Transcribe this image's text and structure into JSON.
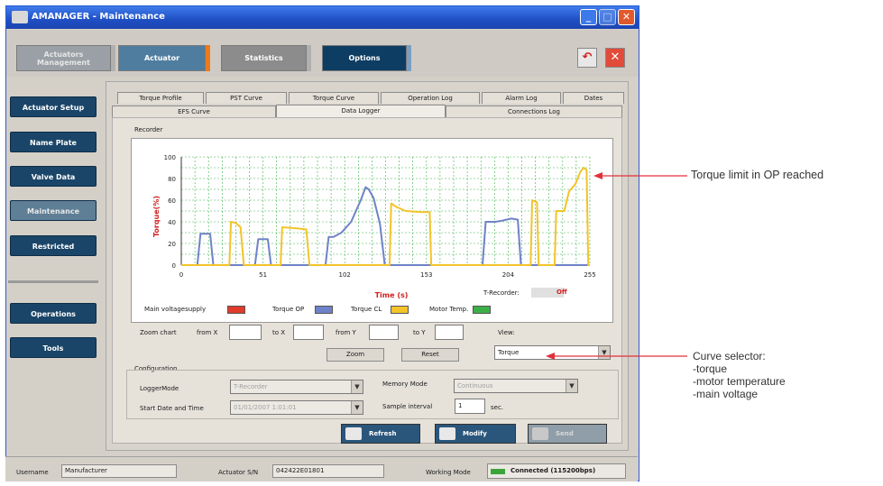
{
  "window": {
    "title": "AMANAGER - Maintenance",
    "min_symbol": "_",
    "max_symbol": "□",
    "close_symbol": "✕"
  },
  "top_tabs": [
    {
      "label": "Actuators Management"
    },
    {
      "label": "Actuator"
    },
    {
      "label": "Statistics"
    },
    {
      "label": "Options"
    }
  ],
  "toolbar_icons": [
    {
      "icon": "undo-icon",
      "glyph": "↶"
    },
    {
      "icon": "exit-icon",
      "glyph": "✕"
    }
  ],
  "sidebar": {
    "items": [
      {
        "label": "Actuator Setup"
      },
      {
        "label": "Name Plate"
      },
      {
        "label": "Valve Data"
      },
      {
        "label": "Maintenance"
      },
      {
        "label": "Restricted"
      },
      {
        "label": "Operations"
      },
      {
        "label": "Tools"
      }
    ]
  },
  "tabs_row1": [
    "Torque Profile",
    "PST Curve",
    "Torque Curve",
    "Operation Log",
    "Alarm Log",
    "Dates"
  ],
  "tabs_row2": [
    "EFS Curve",
    "Data Logger",
    "Connections Log"
  ],
  "recorder": {
    "group_label": "Recorder",
    "t_recorder_label": "T-Recorder:",
    "t_recorder_value": "Off"
  },
  "chart_data": {
    "type": "line",
    "xlabel": "Time (s)",
    "ylabel": "Torque(%)",
    "xlim": [
      0,
      255
    ],
    "ylim": [
      0,
      100
    ],
    "x_ticks": [
      "0",
      "51",
      "102",
      "153",
      "204",
      "255"
    ],
    "y_ticks": [
      "0",
      "20",
      "40",
      "60",
      "80",
      "100"
    ],
    "grid": true,
    "legend_placement": "bottom",
    "series": [
      {
        "name": "Torque OP",
        "color": "#6f82c8",
        "points": [
          [
            0,
            0
          ],
          [
            10,
            0
          ],
          [
            12,
            29
          ],
          [
            18,
            29
          ],
          [
            20,
            0
          ],
          [
            46,
            0
          ],
          [
            48,
            24
          ],
          [
            54,
            24
          ],
          [
            56,
            0
          ],
          [
            90,
            0
          ],
          [
            92,
            26
          ],
          [
            95,
            26
          ],
          [
            100,
            30
          ],
          [
            106,
            40
          ],
          [
            112,
            60
          ],
          [
            115,
            72
          ],
          [
            117,
            70
          ],
          [
            120,
            62
          ],
          [
            124,
            38
          ],
          [
            127,
            0
          ],
          [
            188,
            0
          ],
          [
            190,
            40
          ],
          [
            196,
            40
          ],
          [
            200,
            41
          ],
          [
            206,
            43
          ],
          [
            210,
            42
          ],
          [
            212,
            0
          ],
          [
            255,
            0
          ]
        ]
      },
      {
        "name": "Torque CL",
        "color": "#f3c42a",
        "points": [
          [
            0,
            0
          ],
          [
            30,
            0
          ],
          [
            31,
            40
          ],
          [
            34,
            39
          ],
          [
            37,
            35
          ],
          [
            39,
            0
          ],
          [
            62,
            0
          ],
          [
            63,
            35
          ],
          [
            72,
            34
          ],
          [
            78,
            33
          ],
          [
            80,
            0
          ],
          [
            130,
            0
          ],
          [
            131,
            57
          ],
          [
            134,
            54
          ],
          [
            140,
            50
          ],
          [
            150,
            49
          ],
          [
            155,
            49
          ],
          [
            156,
            0
          ],
          [
            218,
            0
          ],
          [
            219,
            60
          ],
          [
            222,
            58
          ],
          [
            223,
            0
          ],
          [
            233,
            0
          ],
          [
            234,
            50
          ],
          [
            239,
            50
          ],
          [
            242,
            68
          ],
          [
            246,
            75
          ],
          [
            249,
            86
          ],
          [
            251,
            90
          ],
          [
            253,
            88
          ],
          [
            254,
            0
          ],
          [
            255,
            0
          ]
        ]
      },
      {
        "name": "Main voltagesupply",
        "color": "#e03a2a",
        "points": []
      },
      {
        "name": "Motor Temp.",
        "color": "#3cb048",
        "points": []
      }
    ]
  },
  "legend": [
    {
      "label": "Main voltagesupply",
      "color": "#e03a2a"
    },
    {
      "label": "Torque OP",
      "color": "#6f82c8"
    },
    {
      "label": "Torque CL",
      "color": "#f3c42a"
    },
    {
      "label": "Motor Temp.",
      "color": "#3cb048"
    }
  ],
  "zoom": {
    "label": "Zoom chart",
    "from_x": "from X",
    "to_x": "to X",
    "from_y": "from Y",
    "to_y": "to Y",
    "zoom_button": "Zoom",
    "reset_button": "Reset",
    "view_label": "View:",
    "view_value": "Torque"
  },
  "configuration": {
    "group_label": "Configuration",
    "logger_mode_label": "LoggerMode",
    "logger_mode_value": "T-Recorder",
    "memory_mode_label": "Memory Mode",
    "memory_mode_value": "Continuous",
    "start_label": "Start Date and Time",
    "start_value": "01/01/2007  1:01:01",
    "sample_label": "Sample interval",
    "sample_value": "1",
    "sample_unit": "sec."
  },
  "actions": {
    "refresh": "Refresh",
    "modify": "Modify",
    "send": "Send"
  },
  "status": {
    "username_label": "Username",
    "username_value": "Manufacturer",
    "sn_label": "Actuator S/N",
    "sn_value": "042422E01801",
    "mode_label": "Working Mode",
    "mode_value": "Connected (115200bps)"
  },
  "annotations": {
    "torque_limit": "Torque limit in OP reached",
    "curve_selector_title": "Curve selector:",
    "curve_selector_items": [
      "-torque",
      "-motor temperature",
      "-main voltage"
    ]
  }
}
